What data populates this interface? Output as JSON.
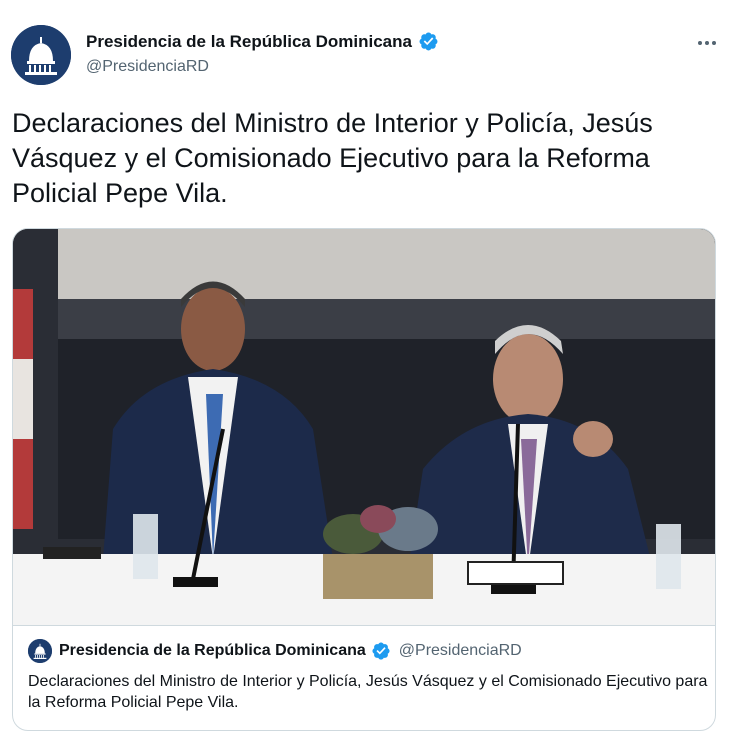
{
  "author": {
    "name": "Presidencia de la República Dominicana",
    "handle": "@PresidenciaRD",
    "verified_icon": "verified-badge-icon"
  },
  "tweet": {
    "text": "Declaraciones del Ministro de Interior y Policía, Jesús Vásquez  y el Comisionado Ejecutivo para la Reforma Policial Pepe Vila."
  },
  "card": {
    "name": "Presidencia de la República Dominicana",
    "handle": "@PresidenciaRD",
    "text": "Declaraciones del Ministro de Interior y Policía, Jesús Vásquez  y el Comisionado Ejecutivo para la Reforma Policial Pepe Vila."
  },
  "colors": {
    "accent": "#1d9bf0",
    "text": "#0f1419",
    "secondary": "#536471",
    "border": "#cfd9de",
    "avatar": "#1d3d6e"
  }
}
